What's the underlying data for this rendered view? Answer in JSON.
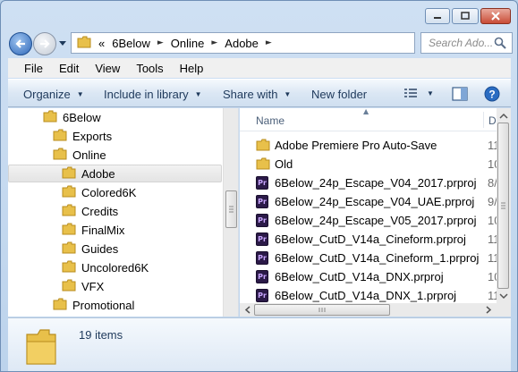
{
  "address": {
    "overflow": "«",
    "crumbs": [
      "6Below",
      "Online",
      "Adobe"
    ]
  },
  "search": {
    "placeholder": "Search Ado..."
  },
  "menu": [
    "File",
    "Edit",
    "View",
    "Tools",
    "Help"
  ],
  "toolbar": {
    "organize": "Organize",
    "include_in_library": "Include in library",
    "share_with": "Share with",
    "new_folder": "New folder"
  },
  "nav_tree": [
    {
      "label": "6Below",
      "level": 1
    },
    {
      "label": "Exports",
      "level": 2
    },
    {
      "label": "Online",
      "level": 2
    },
    {
      "label": "Adobe",
      "level": 3,
      "selected": true
    },
    {
      "label": "Colored6K",
      "level": 3
    },
    {
      "label": "Credits",
      "level": 3
    },
    {
      "label": "FinalMix",
      "level": 3
    },
    {
      "label": "Guides",
      "level": 3
    },
    {
      "label": "Uncolored6K",
      "level": 3
    },
    {
      "label": "VFX",
      "level": 3
    },
    {
      "label": "Promotional",
      "level": 2
    }
  ],
  "columns": {
    "name": "Name",
    "date": "D"
  },
  "files": [
    {
      "name": "Adobe Premiere Pro Auto-Save",
      "type": "folder",
      "date": "11"
    },
    {
      "name": "Old",
      "type": "folder",
      "date": "10"
    },
    {
      "name": "6Below_24p_Escape_V04_2017.prproj",
      "type": "prproj",
      "date": "8/"
    },
    {
      "name": "6Below_24p_Escape_V04_UAE.prproj",
      "type": "prproj",
      "date": "9/"
    },
    {
      "name": "6Below_24p_Escape_V05_2017.prproj",
      "type": "prproj",
      "date": "10"
    },
    {
      "name": "6Below_CutD_V14a_Cineform.prproj",
      "type": "prproj",
      "date": "11"
    },
    {
      "name": "6Below_CutD_V14a_Cineform_1.prproj",
      "type": "prproj",
      "date": "11"
    },
    {
      "name": "6Below_CutD_V14a_DNX.prproj",
      "type": "prproj",
      "date": "10"
    },
    {
      "name": "6Below_CutD_V14a_DNX_1.prproj",
      "type": "prproj",
      "date": "11"
    }
  ],
  "status": {
    "item_count": "19 items"
  },
  "colors": {
    "folder": "#e8c04a",
    "premiere": "#2b1a48",
    "accent": "#1e395b"
  }
}
